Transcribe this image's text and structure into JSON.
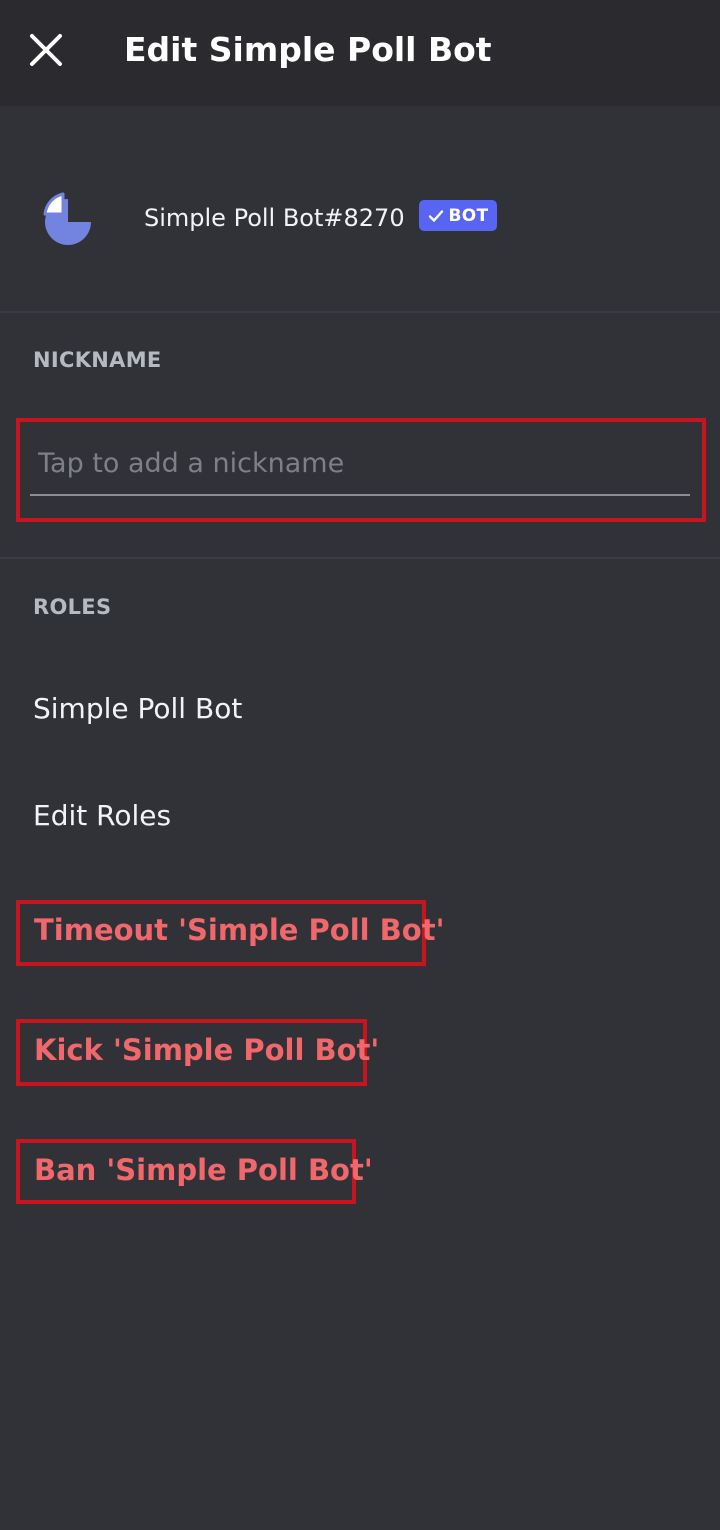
{
  "header": {
    "title": "Edit Simple Poll Bot",
    "close_icon": "close-icon"
  },
  "profile": {
    "avatar_icon": "poll-chart-icon",
    "username": "Simple Poll Bot#8270",
    "badge": {
      "icon": "check-icon",
      "label": "BOT",
      "color": "#5865f2"
    }
  },
  "nickname": {
    "section_label": "NICKNAME",
    "value": "",
    "placeholder": "Tap to add a nickname"
  },
  "roles": {
    "section_label": "ROLES",
    "items": [
      "Simple Poll Bot",
      "Edit Roles"
    ]
  },
  "actions": [
    "Timeout 'Simple Poll Bot'",
    "Kick 'Simple Poll Bot'",
    "Ban 'Simple Poll Bot'"
  ],
  "colors": {
    "background": "#313138",
    "header": "#2a2a2f",
    "danger": "#f0686b",
    "highlight": "#c8141e",
    "accent": "#5865f2"
  }
}
